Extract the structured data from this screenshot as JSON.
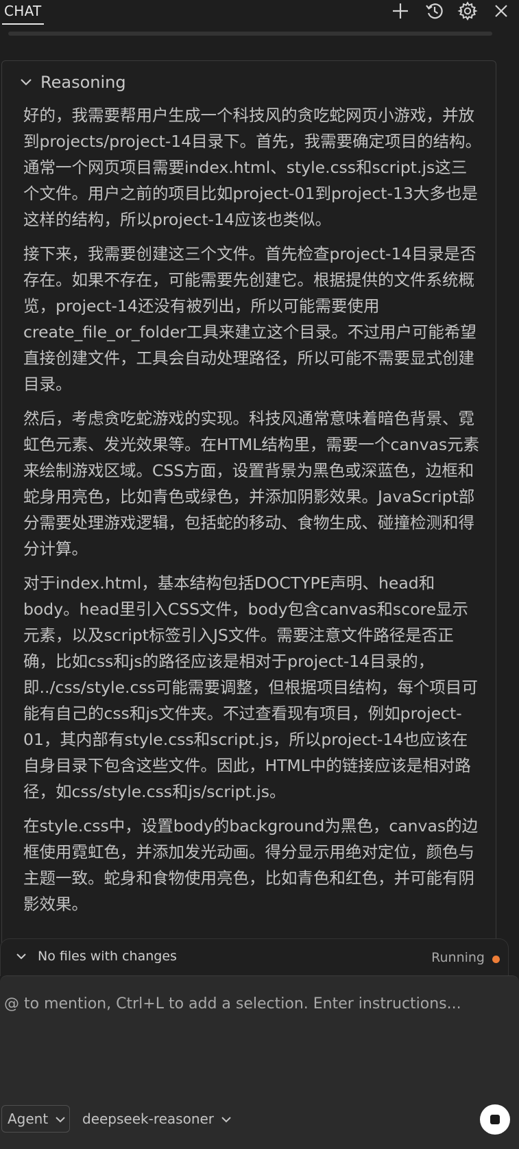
{
  "header": {
    "tab_label": "CHAT",
    "icons": [
      "plus-icon",
      "history-icon",
      "gear-icon",
      "close-icon"
    ]
  },
  "reasoning": {
    "title": "Reasoning",
    "paragraphs": [
      "好的，我需要帮用户生成一个科技风的贪吃蛇网页小游戏，并放到projects/project-14目录下。首先，我需要确定项目的结构。通常一个网页项目需要index.html、style.css和script.js这三个文件。用户之前的项目比如project-01到project-13大多也是这样的结构，所以project-14应该也类似。",
      "接下来，我需要创建这三个文件。首先检查project-14目录是否存在。如果不存在，可能需要先创建它。根据提供的文件系统概览，project-14还没有被列出，所以可能需要使用create_file_or_folder工具来建立这个目录。不过用户可能希望直接创建文件，工具会自动处理路径，所以可能不需要显式创建目录。",
      "然后，考虑贪吃蛇游戏的实现。科技风通常意味着暗色背景、霓虹色元素、发光效果等。在HTML结构里，需要一个canvas元素来绘制游戏区域。CSS方面，设置背景为黑色或深蓝色，边框和蛇身用亮色，比如青色或绿色，并添加阴影效果。JavaScript部分需要处理游戏逻辑，包括蛇的移动、食物生成、碰撞检测和得分计算。",
      "对于index.html，基本结构包括DOCTYPE声明、head和body。head里引入CSS文件，body包含canvas和score显示元素，以及script标签引入JS文件。需要注意文件路径是否正确，比如css和js的路径应该是相对于project-14目录的，即../css/style.css可能需要调整，但根据项目结构，每个项目可能有自己的css和js文件夹。不过查看现有项目，例如project-01，其内部有style.css和script.js，所以project-14也应该在自身目录下包含这些文件。因此，HTML中的链接应该是相对路径，如css/style.css和js/script.js。",
      "在style.css中，设置body的background为黑色，canvas的边框使用霓虹色，并添加发光动画。得分显示用绝对定位，颜色与主题一致。蛇身和食物使用亮色，比如青色和红色，并可能有阴影效果。"
    ]
  },
  "status_bar": {
    "files_label": "No files with changes",
    "run_status": "Running",
    "run_status_color": "#ee7e38"
  },
  "input": {
    "placeholder": "@ to mention, Ctrl+L to add a selection. Enter instructions...",
    "mode_label": "Agent",
    "model_label": "deepseek-reasoner"
  }
}
